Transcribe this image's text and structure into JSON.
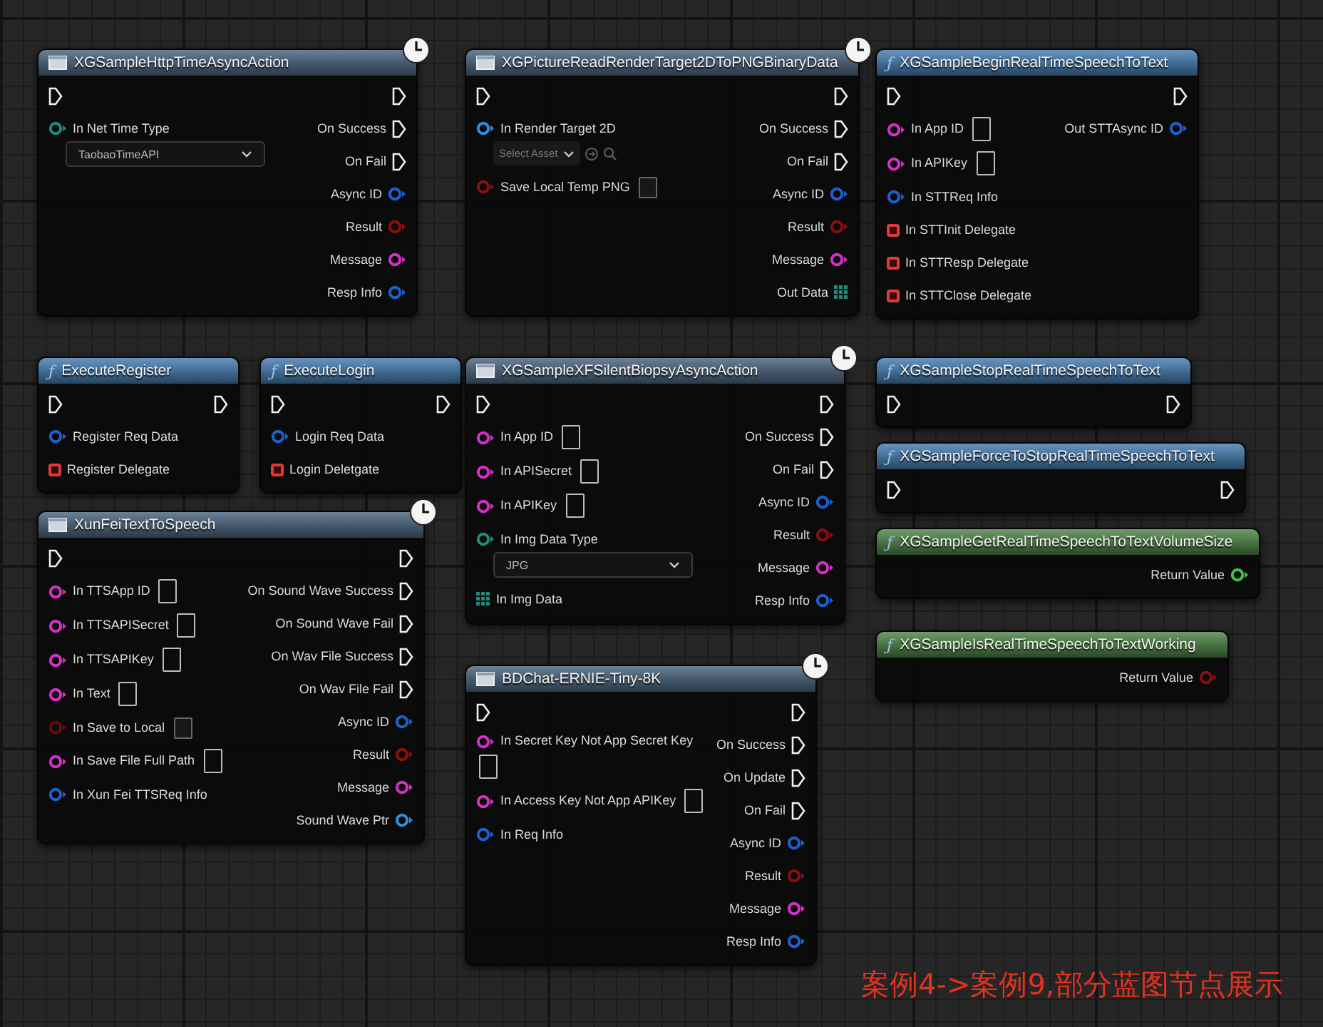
{
  "nodes": [
    {
      "title": "XGSampleHttpTimeAsyncAction",
      "kind": "async",
      "inputs": [
        {
          "kind": "exec"
        },
        {
          "kind": "data",
          "color": "#1e8c7a",
          "label": "In Net Time Type",
          "field": {
            "kind": "dropdown",
            "value": "TaobaoTimeAPI"
          }
        }
      ],
      "outputs": [
        {
          "kind": "exec"
        },
        {
          "kind": "exec",
          "label": "On Success"
        },
        {
          "kind": "exec",
          "label": "On Fail"
        },
        {
          "kind": "data",
          "color": "#1f5fd0",
          "label": "Async ID"
        },
        {
          "kind": "data",
          "color": "#8a0f0f",
          "label": "Result"
        },
        {
          "kind": "data",
          "color": "#d630c8",
          "label": "Message"
        },
        {
          "kind": "data",
          "color": "#1f5fd0",
          "label": "Resp Info"
        }
      ]
    },
    {
      "title": "XGPictureReadRenderTarget2DToPNGBinaryData",
      "kind": "async",
      "inputs": [
        {
          "kind": "exec"
        },
        {
          "kind": "data",
          "color": "#2d8fe0",
          "label": "In Render Target 2D",
          "field": {
            "kind": "asset",
            "placeholder": "Select Asset"
          }
        },
        {
          "kind": "data",
          "color": "#8a0f0f",
          "label": "Save Local Temp PNG",
          "field": {
            "kind": "checkbox",
            "checked": false
          }
        }
      ],
      "outputs": [
        {
          "kind": "exec"
        },
        {
          "kind": "exec",
          "label": "On Success"
        },
        {
          "kind": "exec",
          "label": "On Fail"
        },
        {
          "kind": "data",
          "color": "#1f5fd0",
          "label": "Async ID"
        },
        {
          "kind": "data",
          "color": "#8a0f0f",
          "label": "Result"
        },
        {
          "kind": "data",
          "color": "#d630c8",
          "label": "Message"
        },
        {
          "kind": "array",
          "color": "#1e8c7a",
          "label": "Out Data"
        }
      ]
    },
    {
      "title": "XGSampleBeginRealTimeSpeechToText",
      "kind": "function",
      "icon": "ƒ",
      "inputs": [
        {
          "kind": "exec"
        },
        {
          "kind": "data",
          "color": "#d630c8",
          "label": "In App ID",
          "field": {
            "kind": "text"
          }
        },
        {
          "kind": "data",
          "color": "#d630c8",
          "label": "In APIKey",
          "field": {
            "kind": "text"
          }
        },
        {
          "kind": "data",
          "color": "#1f5fd0",
          "label": "In STTReq Info"
        },
        {
          "kind": "delegate",
          "color": "#e03a3a",
          "label": "In STTInit Delegate"
        },
        {
          "kind": "delegate",
          "color": "#e03a3a",
          "label": "In STTResp Delegate"
        },
        {
          "kind": "delegate",
          "color": "#e03a3a",
          "label": "In STTClose Delegate"
        }
      ],
      "outputs": [
        {
          "kind": "exec"
        },
        {
          "kind": "data",
          "color": "#1f5fd0",
          "label": "Out STTAsync ID"
        }
      ]
    },
    {
      "title": "ExecuteRegister",
      "kind": "function",
      "icon": "ƒ",
      "inputs": [
        {
          "kind": "exec"
        },
        {
          "kind": "data",
          "color": "#1f5fd0",
          "label": "Register Req Data"
        },
        {
          "kind": "delegate",
          "color": "#e03a3a",
          "label": "Register Delegate"
        }
      ],
      "outputs": [
        {
          "kind": "exec"
        }
      ]
    },
    {
      "title": "ExecuteLogin",
      "kind": "function",
      "icon": "ƒ",
      "inputs": [
        {
          "kind": "exec"
        },
        {
          "kind": "data",
          "color": "#1f5fd0",
          "label": "Login Req Data"
        },
        {
          "kind": "delegate",
          "color": "#e03a3a",
          "label": "Login Deletgate"
        }
      ],
      "outputs": [
        {
          "kind": "exec"
        }
      ]
    },
    {
      "title": "XunFeiTextToSpeech",
      "kind": "async",
      "inputs": [
        {
          "kind": "exec"
        },
        {
          "kind": "data",
          "color": "#d630c8",
          "label": "In TTSApp ID",
          "field": {
            "kind": "text"
          }
        },
        {
          "kind": "data",
          "color": "#d630c8",
          "label": "In TTSAPISecret",
          "field": {
            "kind": "text"
          }
        },
        {
          "kind": "data",
          "color": "#d630c8",
          "label": "In TTSAPIKey",
          "field": {
            "kind": "text"
          }
        },
        {
          "kind": "data",
          "color": "#d630c8",
          "label": "In Text",
          "field": {
            "kind": "text"
          }
        },
        {
          "kind": "data",
          "color": "#6a0c0c",
          "label": "In Save to Local",
          "field": {
            "kind": "checkbox",
            "checked": false
          }
        },
        {
          "kind": "data",
          "color": "#d630c8",
          "label": "In Save File Full Path",
          "field": {
            "kind": "text"
          }
        },
        {
          "kind": "data",
          "color": "#1f5fd0",
          "label": "In Xun Fei TTSReq Info"
        }
      ],
      "outputs": [
        {
          "kind": "exec"
        },
        {
          "kind": "exec",
          "label": "On Sound Wave Success"
        },
        {
          "kind": "exec",
          "label": "On Sound Wave Fail"
        },
        {
          "kind": "exec",
          "label": "On Wav File Success"
        },
        {
          "kind": "exec",
          "label": "On Wav File Fail"
        },
        {
          "kind": "data",
          "color": "#1f5fd0",
          "label": "Async ID"
        },
        {
          "kind": "data",
          "color": "#8a0f0f",
          "label": "Result"
        },
        {
          "kind": "data",
          "color": "#d630c8",
          "label": "Message"
        },
        {
          "kind": "data",
          "color": "#2d8fe0",
          "label": "Sound Wave Ptr"
        }
      ]
    },
    {
      "title": "XGSampleXFSilentBiopsyAsyncAction",
      "kind": "async",
      "inputs": [
        {
          "kind": "exec"
        },
        {
          "kind": "data",
          "color": "#d630c8",
          "label": "In App ID",
          "field": {
            "kind": "text"
          }
        },
        {
          "kind": "data",
          "color": "#d630c8",
          "label": "In APISecret",
          "field": {
            "kind": "text"
          }
        },
        {
          "kind": "data",
          "color": "#d630c8",
          "label": "In APIKey",
          "field": {
            "kind": "text"
          }
        },
        {
          "kind": "data",
          "color": "#1e8c7a",
          "label": "In Img Data Type",
          "field": {
            "kind": "dropdown",
            "value": "JPG"
          }
        },
        {
          "kind": "array",
          "color": "#1e8c7a",
          "label": "In Img Data"
        }
      ],
      "outputs": [
        {
          "kind": "exec"
        },
        {
          "kind": "exec",
          "label": "On Success"
        },
        {
          "kind": "exec",
          "label": "On Fail"
        },
        {
          "kind": "data",
          "color": "#1f5fd0",
          "label": "Async ID"
        },
        {
          "kind": "data",
          "color": "#8a0f0f",
          "label": "Result"
        },
        {
          "kind": "data",
          "color": "#d630c8",
          "label": "Message"
        },
        {
          "kind": "data",
          "color": "#1f5fd0",
          "label": "Resp Info"
        }
      ]
    },
    {
      "title": "BDChat-ERNIE-Tiny-8K",
      "kind": "async",
      "inputs": [
        {
          "kind": "exec"
        },
        {
          "kind": "data",
          "color": "#d630c8",
          "label": "In Secret Key Not App Secret Key",
          "field": {
            "kind": "text"
          }
        },
        {
          "kind": "data",
          "color": "#d630c8",
          "label": "In Access Key Not App APIKey",
          "field": {
            "kind": "text"
          }
        },
        {
          "kind": "data",
          "color": "#1f5fd0",
          "label": "In Req Info"
        }
      ],
      "outputs": [
        {
          "kind": "exec"
        },
        {
          "kind": "exec",
          "label": "On Success"
        },
        {
          "kind": "exec",
          "label": "On Update"
        },
        {
          "kind": "exec",
          "label": "On Fail"
        },
        {
          "kind": "data",
          "color": "#1f5fd0",
          "label": "Async ID"
        },
        {
          "kind": "data",
          "color": "#8a0f0f",
          "label": "Result"
        },
        {
          "kind": "data",
          "color": "#d630c8",
          "label": "Message"
        },
        {
          "kind": "data",
          "color": "#1f5fd0",
          "label": "Resp Info"
        }
      ]
    },
    {
      "title": "XGSampleStopRealTimeSpeechToText",
      "kind": "function",
      "icon": "ƒ",
      "inputs": [
        {
          "kind": "exec"
        }
      ],
      "outputs": [
        {
          "kind": "exec"
        }
      ]
    },
    {
      "title": "XGSampleForceToStopRealTimeSpeechToText",
      "kind": "function",
      "icon": "ƒ",
      "inputs": [
        {
          "kind": "exec"
        }
      ],
      "outputs": [
        {
          "kind": "exec"
        }
      ]
    },
    {
      "title": "XGSampleGetRealTimeSpeechToTextVolumeSize",
      "kind": "pure",
      "icon": "ƒ",
      "outputs": [
        {
          "kind": "data",
          "color": "#3ec43e",
          "label": "Return Value"
        }
      ]
    },
    {
      "title": "XGSampleIsRealTimeSpeechToTextWorking",
      "kind": "pure",
      "icon": "ƒ",
      "outputs": [
        {
          "kind": "data",
          "color": "#8a0f0f",
          "label": "Return Value"
        }
      ]
    }
  ],
  "caption": "案例4->案例9,部分蓝图节点展示"
}
